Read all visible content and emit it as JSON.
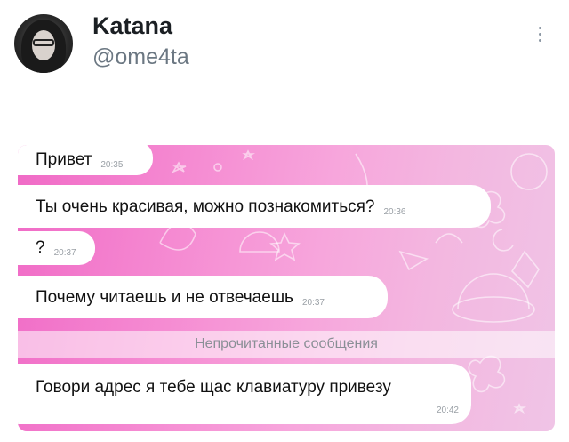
{
  "tweet": {
    "display_name": "Katana",
    "handle": "@ome4ta",
    "avatar_icon": "profile-avatar"
  },
  "chat": {
    "messages": [
      {
        "text": "Привет",
        "time": "20:35"
      },
      {
        "text": "Ты очень красивая, можно познакомиться?",
        "time": "20:36"
      },
      {
        "text": "?",
        "time": "20:37"
      },
      {
        "text": "Почему читаешь и не отвечаешь",
        "time": "20:37"
      },
      {
        "text": "Говори адрес я тебе щас клавиатуру привезу",
        "time": "20:42"
      }
    ],
    "unread_divider": "Непрочитанные сообщения"
  },
  "colors": {
    "background_pink": "#f06ac6",
    "bubble": "#ffffff",
    "name": "#1b1f23",
    "handle": "#6b7782"
  }
}
